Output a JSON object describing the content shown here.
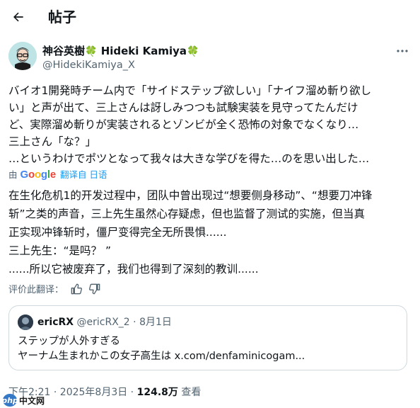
{
  "header": {
    "title": "帖子",
    "back_icon": "arrow-left-icon"
  },
  "author": {
    "display_name": "神谷英樹",
    "display_name_en": "Hideki Kamiya",
    "handle": "@HidekiKamiya_X",
    "badge_icon": "clover-icon"
  },
  "tweet": {
    "lines_ja": [
      "バイオ1開発時チーム内で「サイドステップ欲しい」「ナイフ溜め斬り欲し",
      "い」と声が出て、三上さんは訝しみつつも試験実装を見守ってたんだけ",
      "ど、実際溜め斬りが実装されるとゾンビが全く恐怖の対象でなくなり…",
      "三上さん「な？」",
      "…というわけでポツとなって我々は大きな学びを得た…のを思い出した…"
    ],
    "translation": {
      "by": "由",
      "provider": "Google",
      "link": "翻译自 日语"
    },
    "lines_zh": [
      "在生化危机1的开发过程中，团队中曾出现过“想要侧身移动”、“想要刀冲锋",
      "斩”之类的声音，三上先生虽然心存疑虑，但也监督了测试的实施，但当真",
      "正实现冲锋斩时，僵尸变得完全无所畏惧......",
      "三上先生：“是吗？ ”",
      "......所以它被废弃了，我们也得到了深刻的教训......"
    ],
    "rate_label": "评价此翻译："
  },
  "quote": {
    "name": "ericRX",
    "handle": "@ericRX_2",
    "separator": "·",
    "date": "8月1日",
    "lines": [
      "ステップが人外すぎる",
      "ヤーナム生まれかこの女子高生は x.com/denfaminicogam..."
    ]
  },
  "meta": {
    "time": "下午2:21 · 2025年8月3日 ·",
    "views": "124.8万",
    "views_label": "查看"
  },
  "watermark": {
    "text": "中文网",
    "logo": "php"
  },
  "colors": {
    "link": "#1d9bf0",
    "secondary": "#536471",
    "border": "#cfd9de",
    "clover": "#2e9e3e"
  }
}
